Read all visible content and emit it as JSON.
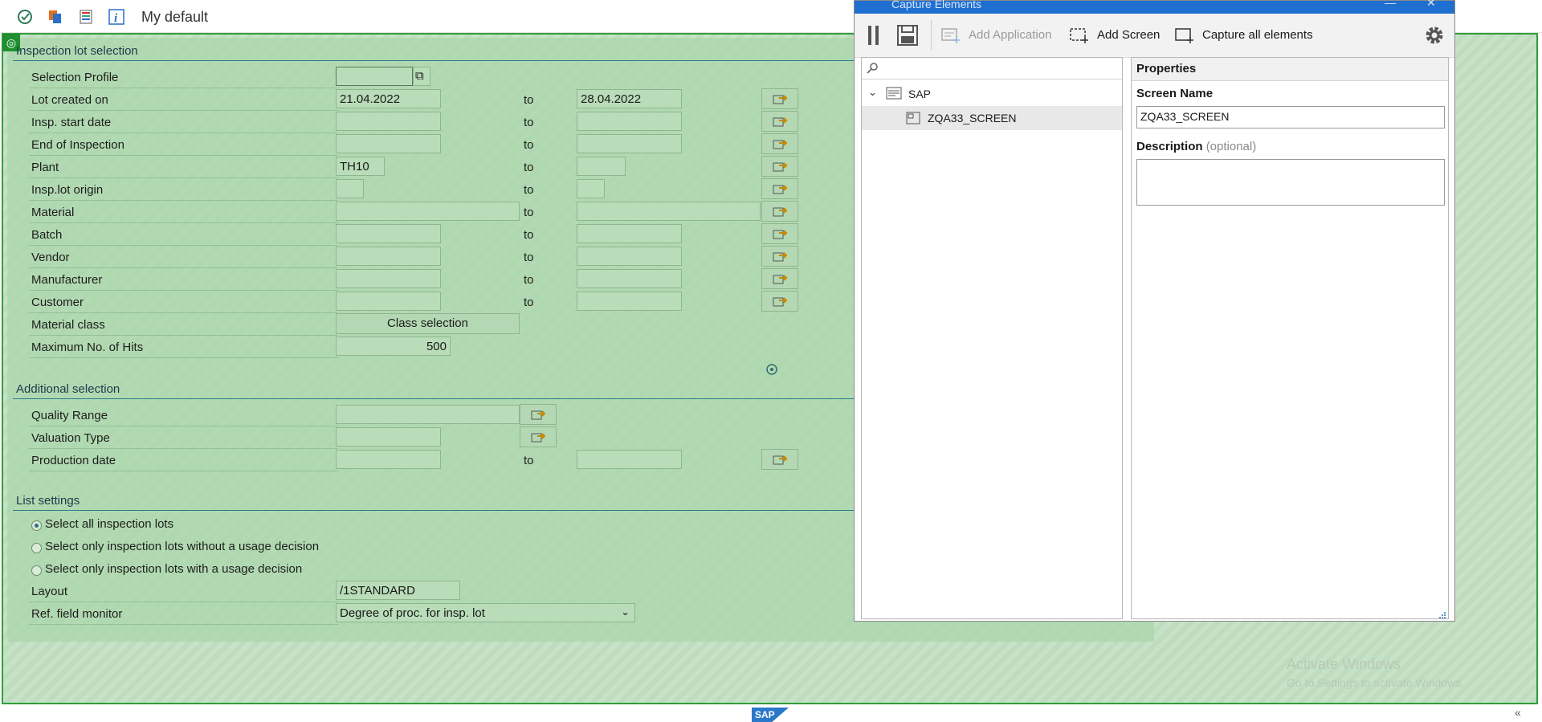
{
  "toolbar": {
    "title": "My default",
    "icons": [
      "execute-icon",
      "variants-icon",
      "layout-icon",
      "info-icon"
    ]
  },
  "sections": {
    "inspection_lot": {
      "title": "Inspection lot selection",
      "to_label": "to",
      "rows": [
        {
          "label": "Selection Profile",
          "from": "",
          "to": null
        },
        {
          "label": "Lot created on",
          "from": "21.04.2022",
          "to": "28.04.2022"
        },
        {
          "label": "Insp. start date",
          "from": "",
          "to": ""
        },
        {
          "label": "End of Inspection",
          "from": "",
          "to": ""
        },
        {
          "label": "Plant",
          "from": "TH10",
          "to": ""
        },
        {
          "label": "Insp.lot origin",
          "from": "",
          "to": ""
        },
        {
          "label": "Material",
          "from": "",
          "to": ""
        },
        {
          "label": "Batch",
          "from": "",
          "to": ""
        },
        {
          "label": "Vendor",
          "from": "",
          "to": ""
        },
        {
          "label": "Manufacturer",
          "from": "",
          "to": ""
        },
        {
          "label": "Customer",
          "from": "",
          "to": ""
        },
        {
          "label": "Material class",
          "button": "Class selection"
        },
        {
          "label": "Maximum No. of Hits",
          "value": "500"
        }
      ]
    },
    "additional": {
      "title": "Additional selection",
      "rows": [
        {
          "label": "Quality Range",
          "from": ""
        },
        {
          "label": "Valuation Type",
          "from": ""
        },
        {
          "label": "Production date",
          "from": "",
          "to": ""
        }
      ]
    },
    "list_settings": {
      "title": "List settings",
      "radios": [
        {
          "label": "Select all inspection lots",
          "checked": true
        },
        {
          "label": "Select only inspection lots without a usage decision",
          "checked": false
        },
        {
          "label": "Select only inspection lots with a usage decision",
          "checked": false
        }
      ],
      "layout_label": "Layout",
      "layout_value": "/1STANDARD",
      "ref_label": "Ref. field monitor",
      "ref_value": "Degree of proc. for insp. lot"
    }
  },
  "capture": {
    "title": "Capture Elements",
    "toolbar": {
      "add_application": "Add Application",
      "add_screen": "Add Screen",
      "capture_all": "Capture all elements"
    },
    "tree": {
      "root": "SAP",
      "child": "ZQA33_SCREEN"
    },
    "properties": {
      "header": "Properties",
      "screen_name_label": "Screen Name",
      "screen_name_value": "ZQA33_SCREEN",
      "description_label": "Description",
      "description_optional": "(optional)",
      "description_value": ""
    }
  },
  "watermark": {
    "line1": "Activate Windows",
    "line2": "Go to Settings to activate Windows."
  },
  "status": {
    "logo": "SAP"
  },
  "colors": {
    "overlay_border": "#2f9f3a",
    "title_bar": "#1f6fd0"
  }
}
